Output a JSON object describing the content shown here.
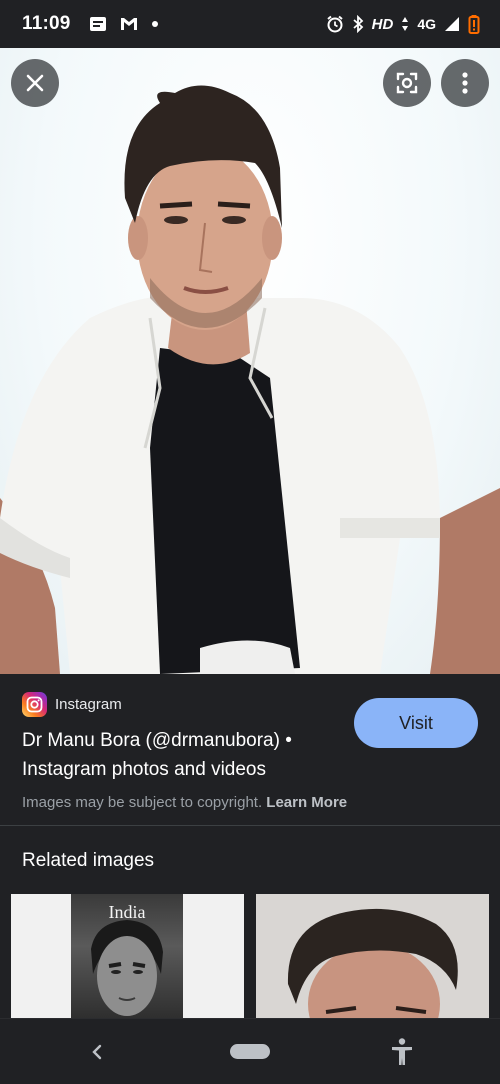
{
  "status_bar": {
    "time": "11:09",
    "network": "HD",
    "signal_type": "4G",
    "icons": [
      "notes-icon",
      "gmail-icon",
      "dot-icon",
      "alarm-icon",
      "bluetooth-icon",
      "data-arrows-icon",
      "signal-icon",
      "battery-low-icon"
    ]
  },
  "viewer": {
    "controls": {
      "close": "close-icon",
      "lens": "google-lens-icon",
      "more": "more-vert-icon"
    }
  },
  "result": {
    "source": "Instagram",
    "source_icon": "instagram-icon",
    "title": "Dr Manu Bora (@drmanubora) • Instagram photos and videos",
    "visit_label": "Visit",
    "copyright_text": "Images may be subject to copyright.",
    "learn_more": "Learn More"
  },
  "related": {
    "heading": "Related images",
    "thumbnails": [
      {
        "caption": "India"
      },
      {
        "caption": ""
      }
    ]
  },
  "nav_bar": {
    "icons": [
      "back-icon",
      "home-pill-icon",
      "accessibility-icon"
    ]
  },
  "colors": {
    "background": "#202124",
    "visit_button": "#8ab4f8",
    "muted_text": "#9aa0a6"
  }
}
